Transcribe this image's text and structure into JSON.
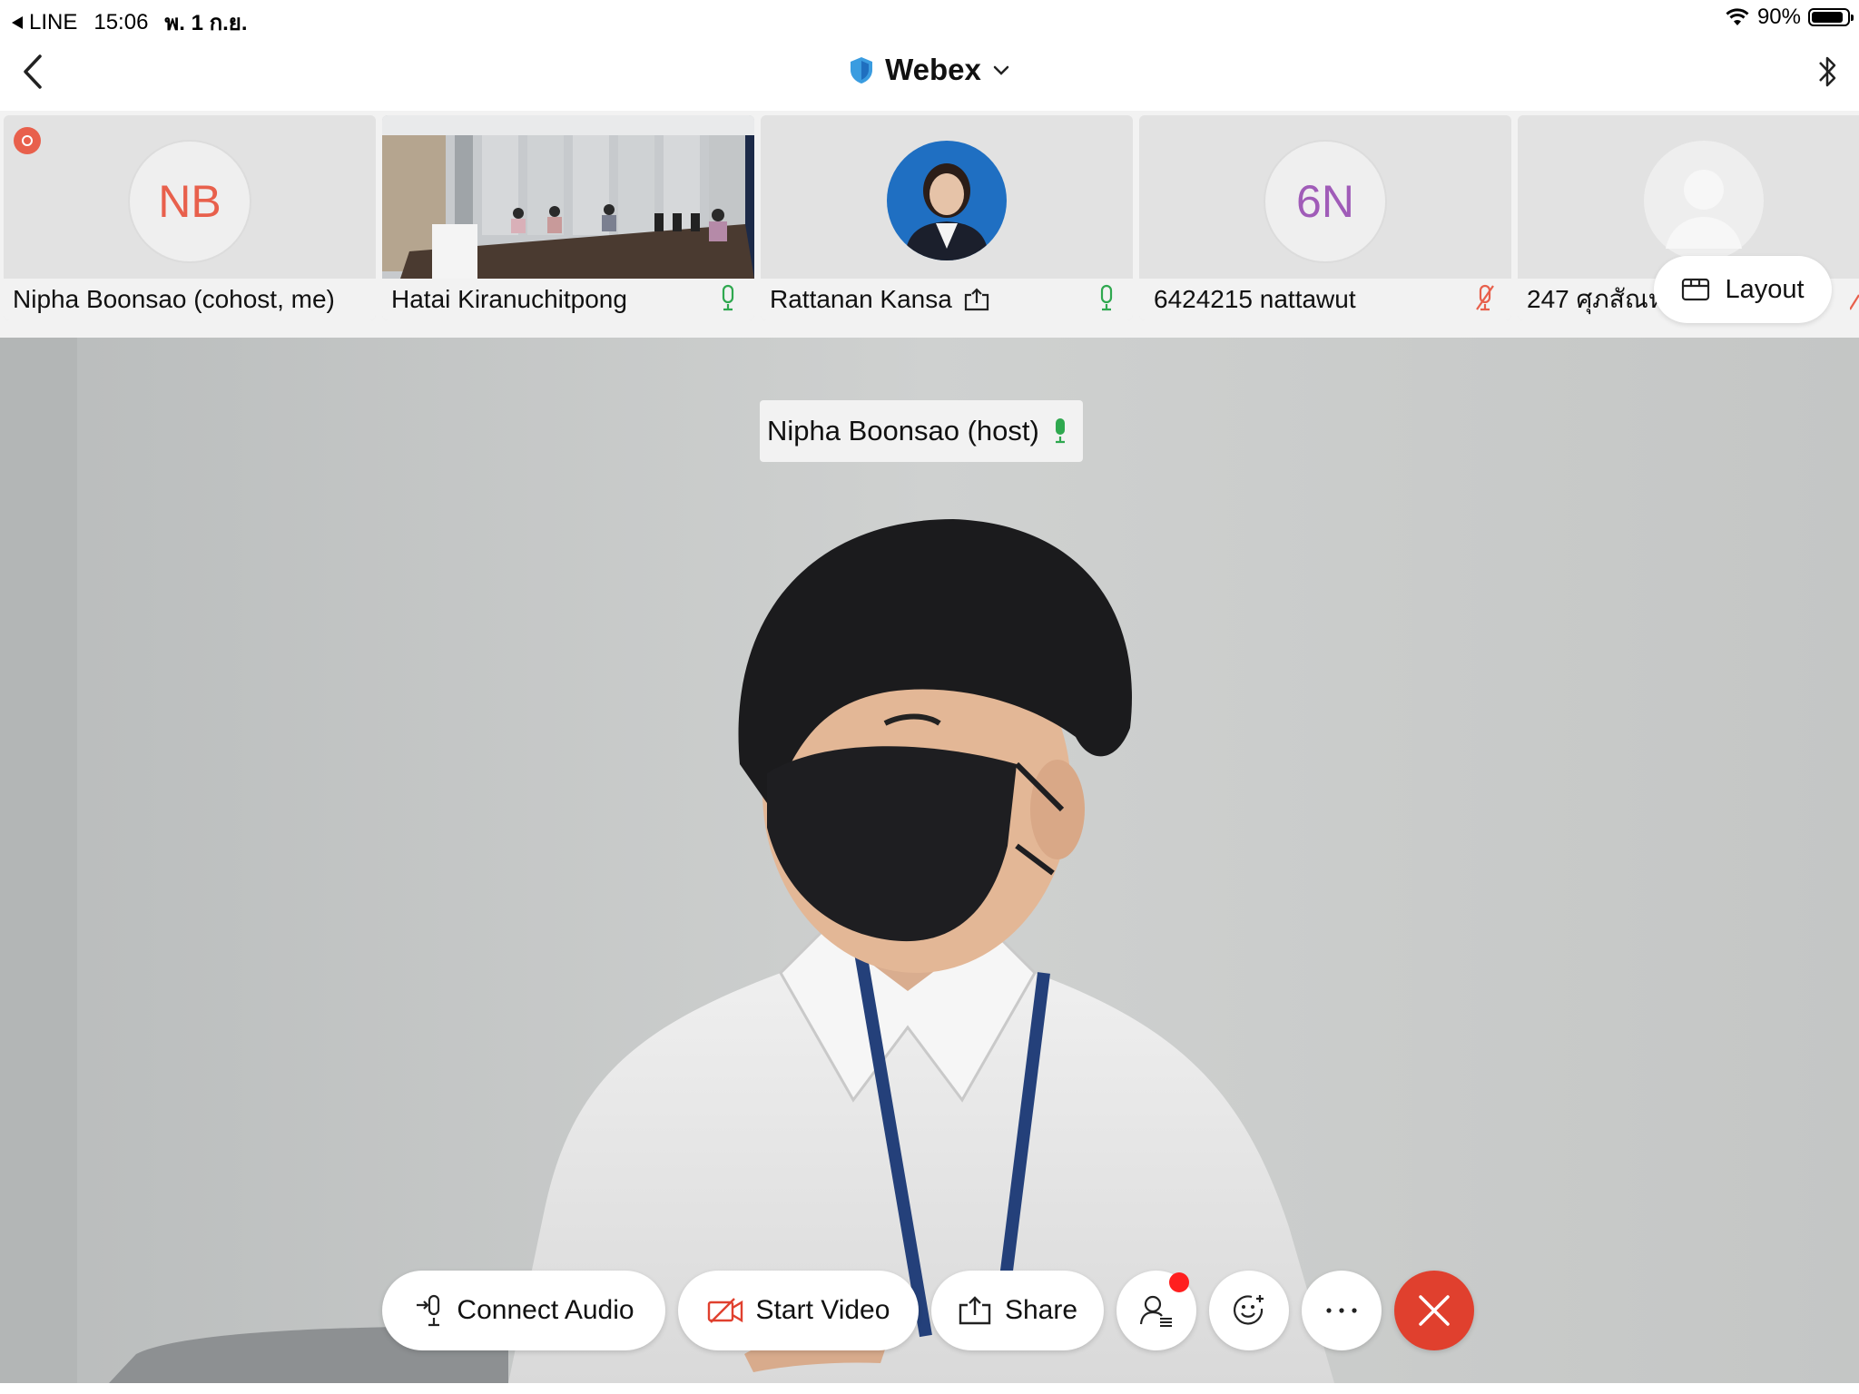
{
  "status_bar": {
    "back_app": "LINE",
    "time": "15:06",
    "date": "พ. 1 ก.ย.",
    "battery": "90%"
  },
  "header": {
    "title": "Webex"
  },
  "participants": [
    {
      "name": "Nipha Boonsao (cohost, me)",
      "initials": "NB",
      "initials_color": "#e8604c",
      "mic": "none"
    },
    {
      "name": "Hatai Kiranuchitpong",
      "initials": "",
      "mic": "on"
    },
    {
      "name": "Rattanan Kansa",
      "initials": "",
      "mic": "on",
      "sharing": true
    },
    {
      "name": "6424215 nattawut",
      "initials": "6N",
      "initials_color": "#a05cb8",
      "mic": "muted"
    },
    {
      "name": "247 ศุภสัณห์",
      "initials": "",
      "mic": "muted"
    }
  ],
  "layout_button": {
    "label": "Layout"
  },
  "main_video": {
    "speaker_label": "Nipha Boonsao (host)"
  },
  "controls": {
    "connect_audio": "Connect Audio",
    "start_video": "Start Video",
    "share": "Share"
  },
  "colors": {
    "mic_on": "#2fa84f",
    "mic_muted": "#e8604c",
    "end_call": "#e0402e",
    "webex_shield": "#3a9ce0"
  }
}
